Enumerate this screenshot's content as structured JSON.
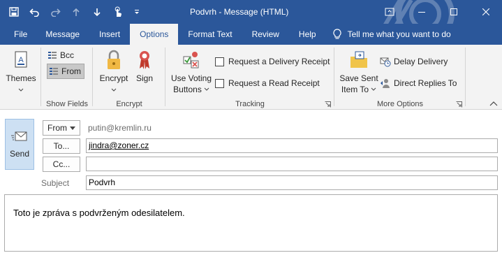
{
  "title": "Podvrh  -  Message (HTML)",
  "colors": {
    "accent": "#2b579a",
    "ribbon_bg": "#f3f3f3",
    "send_bg": "#cde0f3"
  },
  "qat": [
    {
      "icon": "save-icon"
    },
    {
      "icon": "undo-icon"
    },
    {
      "icon": "redo-icon"
    },
    {
      "icon": "up-arrow-icon"
    },
    {
      "icon": "down-arrow-icon"
    },
    {
      "icon": "touch-mode-icon"
    },
    {
      "icon": "customize-qat-icon"
    }
  ],
  "window_buttons": [
    {
      "icon": "restore-ribbon-icon"
    },
    {
      "icon": "minimize-icon"
    },
    {
      "icon": "maximize-icon"
    },
    {
      "icon": "close-icon"
    }
  ],
  "tabs": [
    "File",
    "Message",
    "Insert",
    "Options",
    "Format Text",
    "Review",
    "Help"
  ],
  "active_tab": "Options",
  "tellme": "Tell me what you want to do",
  "ribbon": {
    "themes": {
      "label": "Themes",
      "icon": "themes-icon"
    },
    "show_fields": {
      "bcc": "Bcc",
      "from": "From",
      "group_label": "Show Fields"
    },
    "encrypt": {
      "encrypt": "Encrypt",
      "sign": "Sign",
      "group_label": "Encrypt"
    },
    "tracking": {
      "voting_line1": "Use Voting",
      "voting_line2": "Buttons",
      "delivery_receipt": "Request a Delivery Receipt",
      "read_receipt": "Request a Read Receipt",
      "group_label": "Tracking"
    },
    "more_options": {
      "save_sent_line1": "Save Sent",
      "save_sent_line2": "Item To",
      "delay_delivery": "Delay Delivery",
      "direct_replies": "Direct Replies To",
      "group_label": "More Options"
    }
  },
  "compose": {
    "send_label": "Send",
    "from_label": "From",
    "from_value": "putin@kremlin.ru",
    "to_label": "To...",
    "to_value": "jindra@zoner.cz",
    "cc_label": "Cc...",
    "cc_value": "",
    "subject_label": "Subject",
    "subject_value": "Podvrh",
    "body": "Toto je zpráva s podvrženým odesilatelem."
  }
}
